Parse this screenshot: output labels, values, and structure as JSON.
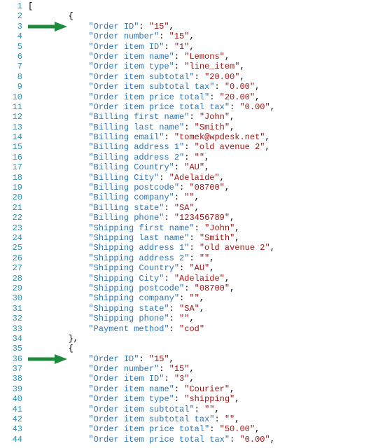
{
  "indent_unit": "    ",
  "lines": [
    {
      "n": 1,
      "indent": 0,
      "kind": "punc",
      "text": "["
    },
    {
      "n": 2,
      "indent": 2,
      "kind": "punc",
      "text": "{"
    },
    {
      "n": 3,
      "indent": 3,
      "kind": "kv",
      "key": "Order ID",
      "value": "15",
      "comma": true,
      "arrow": true
    },
    {
      "n": 4,
      "indent": 3,
      "kind": "kv",
      "key": "Order number",
      "value": "15",
      "comma": true
    },
    {
      "n": 5,
      "indent": 3,
      "kind": "kv",
      "key": "Order item ID",
      "value": "1",
      "comma": true
    },
    {
      "n": 6,
      "indent": 3,
      "kind": "kv",
      "key": "Order item name",
      "value": "Lemons",
      "comma": true
    },
    {
      "n": 7,
      "indent": 3,
      "kind": "kv",
      "key": "Order item type",
      "value": "line_item",
      "comma": true
    },
    {
      "n": 8,
      "indent": 3,
      "kind": "kv",
      "key": "Order item subtotal",
      "value": "20.00",
      "comma": true
    },
    {
      "n": 9,
      "indent": 3,
      "kind": "kv",
      "key": "Order item subtotal tax",
      "value": "0.00",
      "comma": true
    },
    {
      "n": 10,
      "indent": 3,
      "kind": "kv",
      "key": "Order item price total",
      "value": "20.00",
      "comma": true
    },
    {
      "n": 11,
      "indent": 3,
      "kind": "kv",
      "key": "Order item price total tax",
      "value": "0.00",
      "comma": true
    },
    {
      "n": 12,
      "indent": 3,
      "kind": "kv",
      "key": "Billing first name",
      "value": "John",
      "comma": true
    },
    {
      "n": 13,
      "indent": 3,
      "kind": "kv",
      "key": "Billing last name",
      "value": "Smith",
      "comma": true
    },
    {
      "n": 14,
      "indent": 3,
      "kind": "kv",
      "key": "Billing email",
      "value": "tomek@wpdesk.net",
      "comma": true
    },
    {
      "n": 15,
      "indent": 3,
      "kind": "kv",
      "key": "Billing address 1",
      "value": "old avenue 2",
      "comma": true
    },
    {
      "n": 16,
      "indent": 3,
      "kind": "kv",
      "key": "Billing address 2",
      "value": "",
      "comma": true
    },
    {
      "n": 17,
      "indent": 3,
      "kind": "kv",
      "key": "Billing Country",
      "value": "AU",
      "comma": true
    },
    {
      "n": 18,
      "indent": 3,
      "kind": "kv",
      "key": "Billing City",
      "value": "Adelaide",
      "comma": true
    },
    {
      "n": 19,
      "indent": 3,
      "kind": "kv",
      "key": "Billing postcode",
      "value": "08700",
      "comma": true
    },
    {
      "n": 20,
      "indent": 3,
      "kind": "kv",
      "key": "Billing company",
      "value": "",
      "comma": true
    },
    {
      "n": 21,
      "indent": 3,
      "kind": "kv",
      "key": "Billing state",
      "value": "SA",
      "comma": true
    },
    {
      "n": 22,
      "indent": 3,
      "kind": "kv",
      "key": "Billing phone",
      "value": "123456789",
      "comma": true
    },
    {
      "n": 23,
      "indent": 3,
      "kind": "kv",
      "key": "Shipping first name",
      "value": "John",
      "comma": true
    },
    {
      "n": 24,
      "indent": 3,
      "kind": "kv",
      "key": "Shipping last name",
      "value": "Smith",
      "comma": true
    },
    {
      "n": 25,
      "indent": 3,
      "kind": "kv",
      "key": "Shipping address 1",
      "value": "old avenue 2",
      "comma": true
    },
    {
      "n": 26,
      "indent": 3,
      "kind": "kv",
      "key": "Shipping address 2",
      "value": "",
      "comma": true
    },
    {
      "n": 27,
      "indent": 3,
      "kind": "kv",
      "key": "Shipping Country",
      "value": "AU",
      "comma": true
    },
    {
      "n": 28,
      "indent": 3,
      "kind": "kv",
      "key": "Shipping City",
      "value": "Adelaide",
      "comma": true
    },
    {
      "n": 29,
      "indent": 3,
      "kind": "kv",
      "key": "Shipping postcode",
      "value": "08700",
      "comma": true
    },
    {
      "n": 30,
      "indent": 3,
      "kind": "kv",
      "key": "Shipping company",
      "value": "",
      "comma": true
    },
    {
      "n": 31,
      "indent": 3,
      "kind": "kv",
      "key": "Shipping state",
      "value": "SA",
      "comma": true
    },
    {
      "n": 32,
      "indent": 3,
      "kind": "kv",
      "key": "Shipping phone",
      "value": "",
      "comma": true
    },
    {
      "n": 33,
      "indent": 3,
      "kind": "kv",
      "key": "Payment method",
      "value": "cod",
      "comma": false
    },
    {
      "n": 34,
      "indent": 2,
      "kind": "punc",
      "text": "},"
    },
    {
      "n": 35,
      "indent": 2,
      "kind": "punc",
      "text": "{"
    },
    {
      "n": 36,
      "indent": 3,
      "kind": "kv",
      "key": "Order ID",
      "value": "15",
      "comma": true,
      "arrow": true
    },
    {
      "n": 37,
      "indent": 3,
      "kind": "kv",
      "key": "Order number",
      "value": "15",
      "comma": true
    },
    {
      "n": 38,
      "indent": 3,
      "kind": "kv",
      "key": "Order item ID",
      "value": "3",
      "comma": true
    },
    {
      "n": 39,
      "indent": 3,
      "kind": "kv",
      "key": "Order item name",
      "value": "Courier",
      "comma": true
    },
    {
      "n": 40,
      "indent": 3,
      "kind": "kv",
      "key": "Order item type",
      "value": "shipping",
      "comma": true
    },
    {
      "n": 41,
      "indent": 3,
      "kind": "kv",
      "key": "Order item subtotal",
      "value": "",
      "comma": true
    },
    {
      "n": 42,
      "indent": 3,
      "kind": "kv",
      "key": "Order item subtotal tax",
      "value": "",
      "comma": true
    },
    {
      "n": 43,
      "indent": 3,
      "kind": "kv",
      "key": "Order item price total",
      "value": "50.00",
      "comma": true
    },
    {
      "n": 44,
      "indent": 3,
      "kind": "kv",
      "key": "Order item price total tax",
      "value": "0.00",
      "comma": true
    }
  ],
  "arrow_color": "#1e8a3b"
}
